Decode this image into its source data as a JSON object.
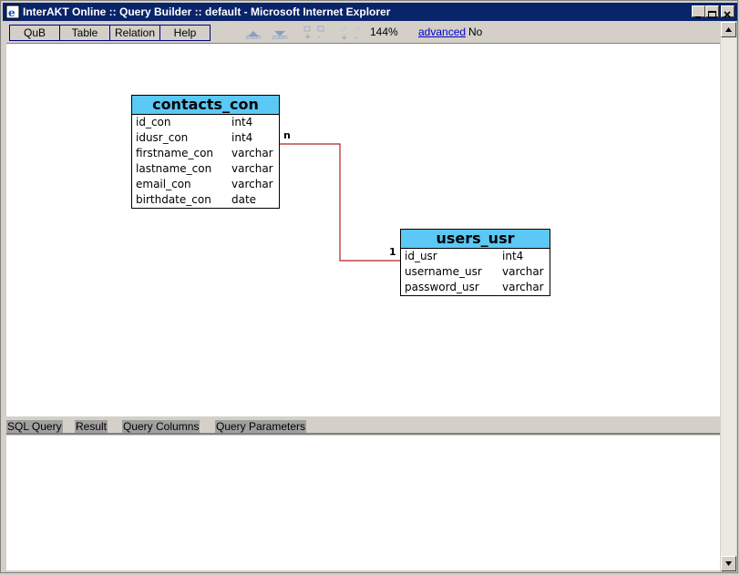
{
  "window": {
    "title": "InterAKT Online :: Query Builder :: default - Microsoft Internet Explorer",
    "controls": [
      "minimize",
      "maximize",
      "close"
    ]
  },
  "menubar": {
    "items": [
      {
        "label": "QuB"
      },
      {
        "label": "Table"
      },
      {
        "label": "Relation"
      },
      {
        "label": "Help"
      }
    ]
  },
  "toolbar": {
    "zoom_in_label": "zoom",
    "zoom_out_label": "zoom",
    "zoom_level": "144%",
    "advanced_link": "advanced",
    "advanced_value": "No",
    "icons": [
      "zoom-in-icon",
      "zoom-out-icon",
      "tile-icon",
      "cascade-icon",
      "expand-icon",
      "collapse-icon"
    ]
  },
  "diagram": {
    "tables": [
      {
        "name": "contacts_con",
        "columns": [
          {
            "name": "id_con",
            "type": "int4"
          },
          {
            "name": "idusr_con",
            "type": "int4"
          },
          {
            "name": "firstname_con",
            "type": "varchar"
          },
          {
            "name": "lastname_con",
            "type": "varchar"
          },
          {
            "name": "email_con",
            "type": "varchar"
          },
          {
            "name": "birthdate_con",
            "type": "date"
          }
        ]
      },
      {
        "name": "users_usr",
        "columns": [
          {
            "name": "id_usr",
            "type": "int4"
          },
          {
            "name": "username_usr",
            "type": "varchar"
          },
          {
            "name": "password_usr",
            "type": "varchar"
          }
        ]
      }
    ],
    "relation": {
      "from": "contacts_con.idusr_con",
      "to": "users_usr.id_usr",
      "from_cardinality": "n",
      "to_cardinality": "1",
      "color": "#b22222"
    }
  },
  "bottom_tabs": [
    {
      "label": "SQL Query"
    },
    {
      "label": "Result"
    },
    {
      "label": "Query Columns"
    },
    {
      "label": "Query Parameters"
    }
  ],
  "colors": {
    "title_bar": "#0a246a",
    "table_header": "#5bc8f5",
    "link": "#0000cc",
    "tab_bg": "#a0a0a0",
    "relation_line": "#b22222"
  }
}
